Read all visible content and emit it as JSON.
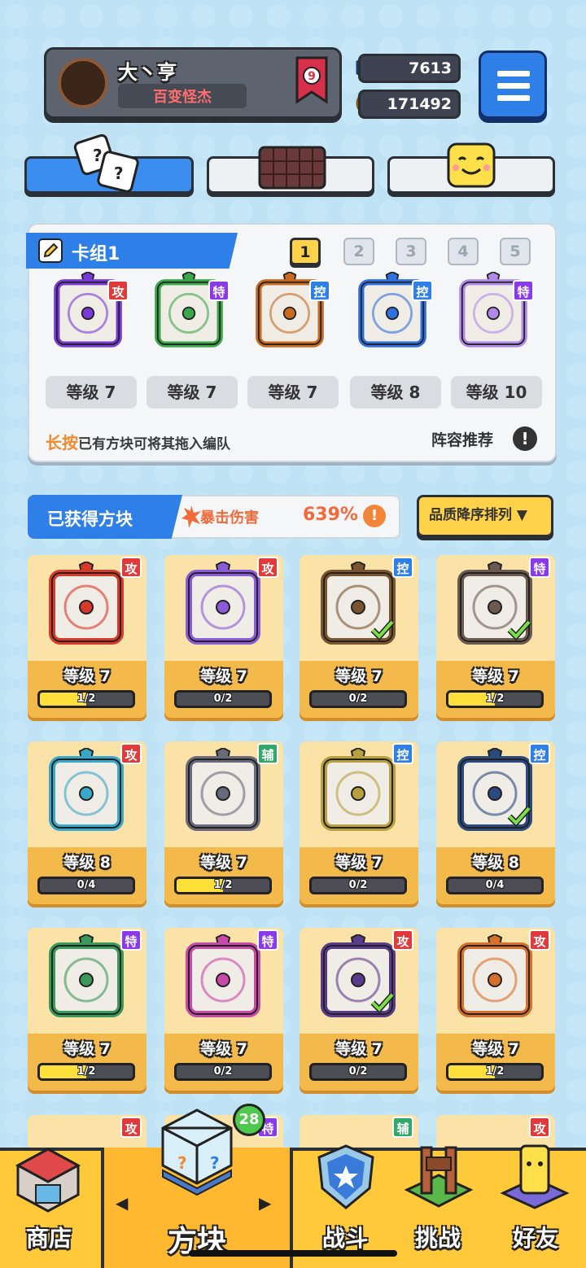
{
  "profile": {
    "name": "大丶亨",
    "title": "百变怪杰",
    "rank": "9",
    "gems": "7613",
    "coins": "171492"
  },
  "deck": {
    "name": "卡组1",
    "pages": [
      "1",
      "2",
      "3",
      "4",
      "5"
    ],
    "active_page": "1",
    "slots": [
      {
        "level": "等级 7",
        "tag": "攻",
        "type": "atk",
        "color": "#7a3ad8"
      },
      {
        "level": "等级 7",
        "tag": "特",
        "type": "spc",
        "color": "#3aa84a"
      },
      {
        "level": "等级 7",
        "tag": "控",
        "type": "ctl",
        "color": "#c86a20"
      },
      {
        "level": "等级 8",
        "tag": "控",
        "type": "ctl",
        "color": "#2f6fe0"
      },
      {
        "level": "等级 10",
        "tag": "特",
        "type": "spc",
        "color": "#b08ae8"
      }
    ],
    "hint_emphasis": "长按",
    "hint_text": "已有方块可将其拖入编队",
    "recommend": "阵容推荐",
    "info": "!"
  },
  "owned": {
    "title": "已获得方块",
    "crit_label": "暴击伤害",
    "crit_value": "639%",
    "info": "!",
    "sort_label": "品质降序排列 ▼",
    "cards": [
      {
        "level": "等级 7",
        "progress": "1/2",
        "fill": 0.5,
        "tag": "攻",
        "type": "atk",
        "color": "#d83a2a",
        "check": false
      },
      {
        "level": "等级 7",
        "progress": "0/2",
        "fill": 0,
        "tag": "攻",
        "type": "atk",
        "color": "#8a5ad8",
        "check": false
      },
      {
        "level": "等级 7",
        "progress": "0/2",
        "fill": 0,
        "tag": "控",
        "type": "ctl",
        "color": "#7a5530",
        "check": true
      },
      {
        "level": "等级 7",
        "progress": "1/2",
        "fill": 0.5,
        "tag": "特",
        "type": "spc",
        "color": "#6a5a50",
        "check": true
      },
      {
        "level": "等级 8",
        "progress": "0/4",
        "fill": 0,
        "tag": "攻",
        "type": "atk",
        "color": "#3aa8c8",
        "check": false
      },
      {
        "level": "等级 7",
        "progress": "1/2",
        "fill": 0.5,
        "tag": "辅",
        "type": "sup",
        "color": "#6a6a7a",
        "check": false
      },
      {
        "level": "等级 7",
        "progress": "0/2",
        "fill": 0,
        "tag": "控",
        "type": "ctl",
        "color": "#b8a040",
        "check": false
      },
      {
        "level": "等级 8",
        "progress": "0/4",
        "fill": 0,
        "tag": "控",
        "type": "ctl",
        "color": "#2a4a80",
        "check": true
      },
      {
        "level": "等级 7",
        "progress": "1/2",
        "fill": 0.5,
        "tag": "特",
        "type": "spc",
        "color": "#3a9a5a",
        "check": false
      },
      {
        "level": "等级 7",
        "progress": "0/2",
        "fill": 0,
        "tag": "特",
        "type": "spc",
        "color": "#c84aa8",
        "check": false
      },
      {
        "level": "等级 7",
        "progress": "0/2",
        "fill": 0,
        "tag": "攻",
        "type": "atk",
        "color": "#5a3a8a",
        "check": true
      },
      {
        "level": "等级 7",
        "progress": "1/2",
        "fill": 0.5,
        "tag": "攻",
        "type": "atk",
        "color": "#d8702a",
        "check": false
      }
    ],
    "partial_row": [
      {
        "tag": "攻",
        "type": "atk"
      },
      {
        "tag": "特",
        "type": "spc"
      },
      {
        "tag": "辅",
        "type": "sup"
      },
      {
        "tag": "攻",
        "type": "atk"
      }
    ]
  },
  "nav": {
    "shop": "商店",
    "blocks": "方块",
    "battle": "战斗",
    "challenge": "挑战",
    "friends": "好友",
    "blocks_badge": "28"
  },
  "icons": {
    "avatar": "apple-icon",
    "gem": "gem-icon",
    "coin": "coin-icon",
    "menu": "hamburger-icon",
    "edit": "pencil-icon"
  }
}
